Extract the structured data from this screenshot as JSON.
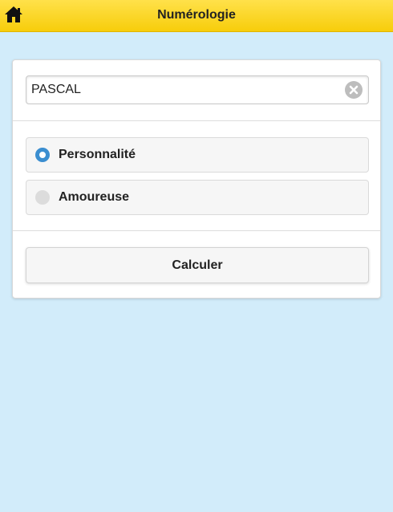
{
  "header": {
    "title": "Numérologie",
    "home_icon": "home-icon",
    "background": "#f9d21a"
  },
  "form": {
    "name_input": {
      "value": "PASCAL",
      "clear_icon": "clear-icon"
    },
    "options": [
      {
        "label": "Personnalité",
        "selected": true
      },
      {
        "label": "Amoureuse",
        "selected": false
      }
    ],
    "submit_label": "Calculer"
  },
  "colors": {
    "page_background": "#d2ecfa",
    "radio_accent": "#3b8ed0"
  }
}
